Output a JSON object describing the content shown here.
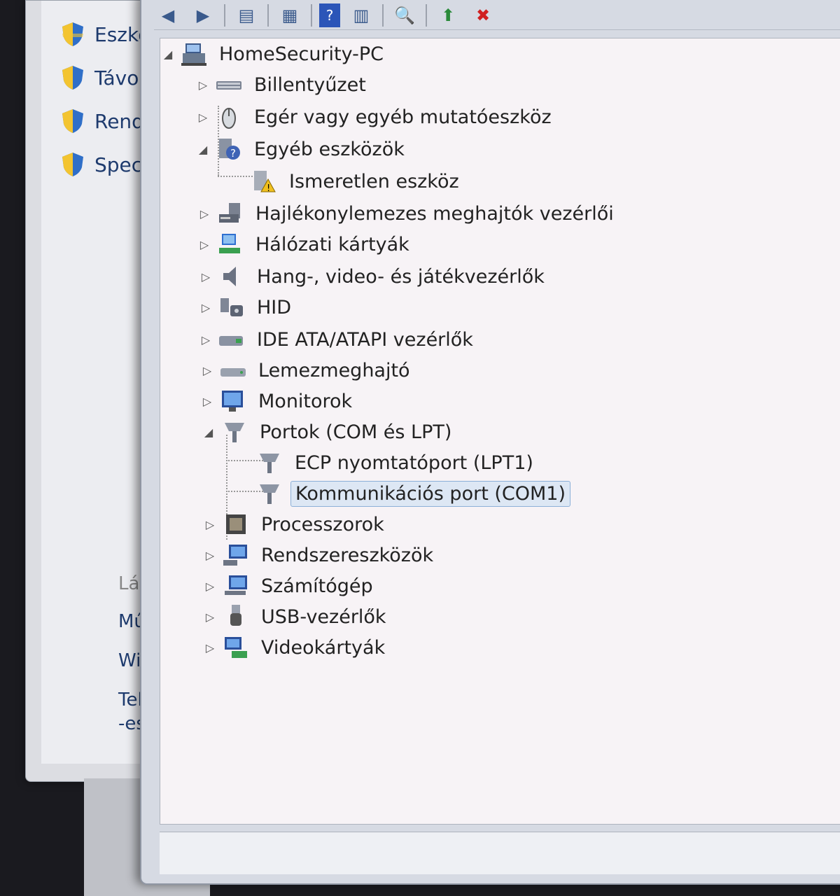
{
  "left_panel": {
    "items": [
      {
        "label": "Eszköz"
      },
      {
        "label": "Távoli"
      },
      {
        "label": "Rends"
      },
      {
        "label": "Specia"
      }
    ],
    "see_also": {
      "header": "Lásd m",
      "links": [
        "Művel",
        "Windo",
        "Teljesí",
        "-eszkö"
      ]
    }
  },
  "tree": {
    "root": "HomeSecurity-PC",
    "categories": [
      {
        "label": "Billentyűzet",
        "icon": "keyboard-icon",
        "expanded": false
      },
      {
        "label": "Egér vagy egyéb mutatóeszköz",
        "icon": "mouse-icon",
        "expanded": false
      },
      {
        "label": "Egyéb eszközök",
        "icon": "unknown-device-icon",
        "expanded": true,
        "children": [
          {
            "label": "Ismeretlen eszköz",
            "icon": "warning-device-icon"
          }
        ]
      },
      {
        "label": "Hajlékonylemezes meghajtók vezérlői",
        "icon": "floppy-controller-icon",
        "expanded": false
      },
      {
        "label": "Hálózati kártyák",
        "icon": "network-adapter-icon",
        "expanded": false
      },
      {
        "label": "Hang-, video- és játékvezérlők",
        "icon": "speaker-icon",
        "expanded": false
      },
      {
        "label": "HID",
        "icon": "hid-icon",
        "expanded": false
      },
      {
        "label": "IDE ATA/ATAPI vezérlők",
        "icon": "ide-controller-icon",
        "expanded": false
      },
      {
        "label": "Lemezmeghajtó",
        "icon": "disk-drive-icon",
        "expanded": false
      },
      {
        "label": "Monitorok",
        "icon": "monitor-icon",
        "expanded": false
      },
      {
        "label": "Portok (COM és LPT)",
        "icon": "port-icon",
        "expanded": true,
        "children": [
          {
            "label": "ECP nyomtatóport (LPT1)",
            "icon": "port-icon"
          },
          {
            "label": "Kommunikációs port (COM1)",
            "icon": "port-icon",
            "selected": true
          }
        ]
      },
      {
        "label": "Processzorok",
        "icon": "processor-icon",
        "expanded": false
      },
      {
        "label": "Rendszereszközök",
        "icon": "system-device-icon",
        "expanded": false
      },
      {
        "label": "Számítógép",
        "icon": "computer-icon",
        "expanded": false
      },
      {
        "label": "USB-vezérlők",
        "icon": "usb-icon",
        "expanded": false
      },
      {
        "label": "Videokártyák",
        "icon": "display-adapter-icon",
        "expanded": false
      }
    ]
  },
  "toolbar": {
    "buttons": [
      "back-icon",
      "forward-icon",
      "show-hide-tree-icon",
      "properties-icon",
      "help-icon",
      "action-pane-icon",
      "scan-hardware-icon",
      "update-driver-icon",
      "uninstall-icon"
    ]
  }
}
